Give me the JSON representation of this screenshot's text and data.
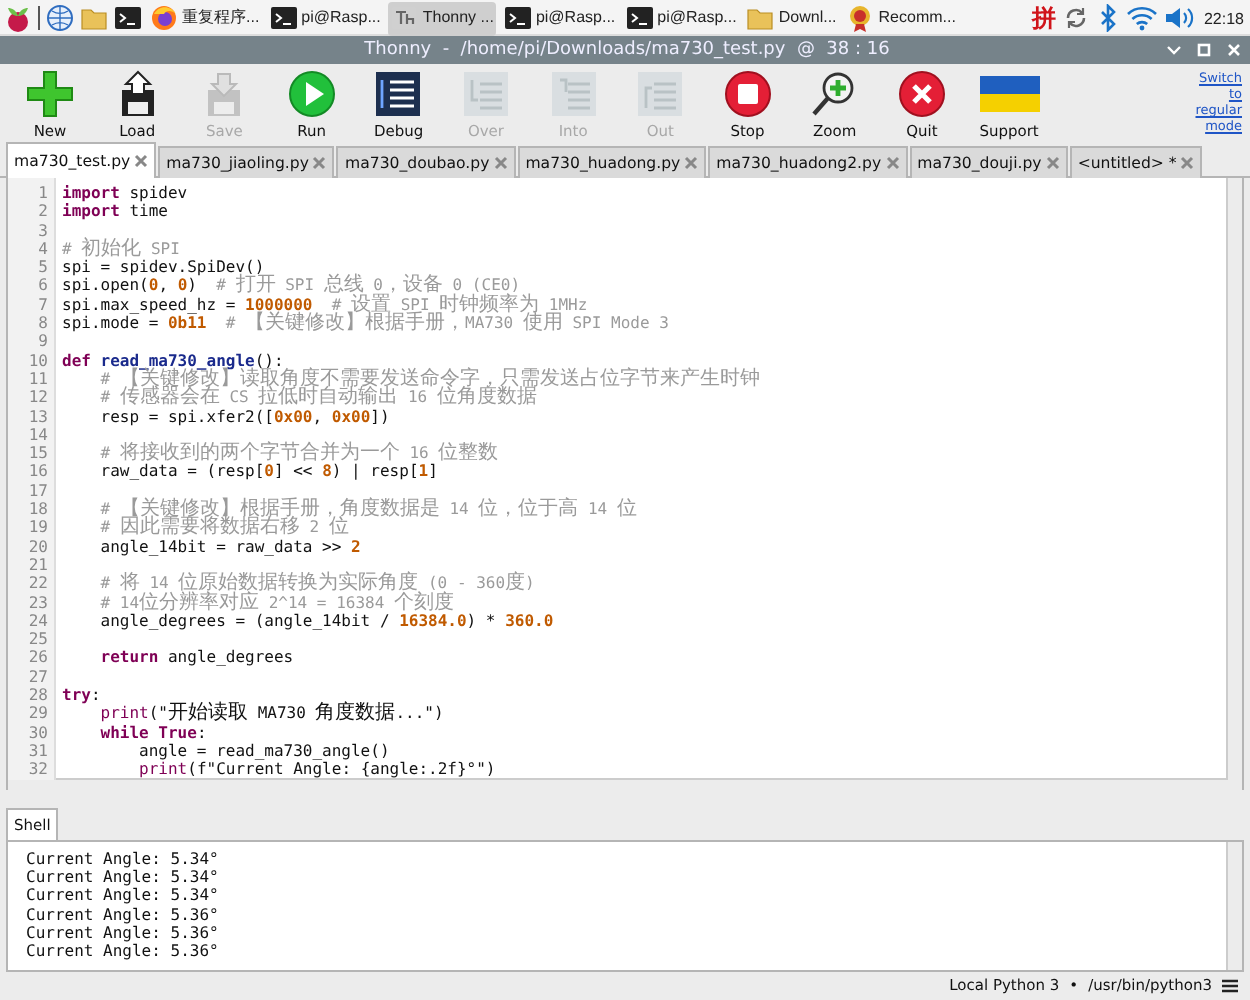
{
  "taskbar": {
    "windows": [
      {
        "kind": "firefox",
        "label": "重复程序...",
        "selected": false
      },
      {
        "kind": "terminal",
        "label": "pi@Rasp...",
        "selected": false
      },
      {
        "kind": "thonny",
        "label": "Thonny ...",
        "selected": true
      },
      {
        "kind": "terminal",
        "label": "pi@Rasp...",
        "selected": false
      },
      {
        "kind": "terminal",
        "label": "pi@Rasp...",
        "selected": false
      },
      {
        "kind": "folder",
        "label": "Downl...",
        "selected": false
      },
      {
        "kind": "rosette",
        "label": "Recomm...",
        "selected": false
      }
    ],
    "ime": "拼",
    "clock": "22:18"
  },
  "window": {
    "title": "Thonny  -  /home/pi/Downloads/ma730_test.py  @  38 : 16"
  },
  "toolbar": [
    {
      "kind": "new",
      "label": "New",
      "disabled": false
    },
    {
      "kind": "load",
      "label": "Load",
      "disabled": false
    },
    {
      "kind": "save",
      "label": "Save",
      "disabled": true
    },
    {
      "kind": "run",
      "label": "Run",
      "disabled": false
    },
    {
      "kind": "debug",
      "label": "Debug",
      "disabled": false
    },
    {
      "kind": "over",
      "label": "Over",
      "disabled": true
    },
    {
      "kind": "into",
      "label": "Into",
      "disabled": true
    },
    {
      "kind": "out",
      "label": "Out",
      "disabled": true
    },
    {
      "kind": "stop",
      "label": "Stop",
      "disabled": false
    },
    {
      "kind": "zoom",
      "label": "Zoom",
      "disabled": false
    },
    {
      "kind": "quit",
      "label": "Quit",
      "disabled": false
    },
    {
      "kind": "support",
      "label": "Support",
      "disabled": false
    }
  ],
  "mode_link": "Switch to regular mode",
  "editor_tabs": [
    {
      "label": "ma730_test.py",
      "selected": true
    },
    {
      "label": "ma730_jiaoling.py",
      "selected": false
    },
    {
      "label": "ma730_doubao.py",
      "selected": false
    },
    {
      "label": "ma730_huadong.py",
      "selected": false
    },
    {
      "label": "ma730_huadong2.py",
      "selected": false
    },
    {
      "label": "ma730_douji.py",
      "selected": false
    },
    {
      "label": "<untitled> *",
      "selected": false
    }
  ],
  "code_lines": [
    {
      "number": "1",
      "tokens": [
        {
          "kind": "keyword",
          "text": "import"
        },
        {
          "kind": "plain",
          "text": " spidev"
        }
      ]
    },
    {
      "number": "2",
      "tokens": [
        {
          "kind": "keyword",
          "text": "import"
        },
        {
          "kind": "plain",
          "text": " time"
        }
      ]
    },
    {
      "number": "3"
    },
    {
      "number": "4",
      "tokens": [
        {
          "kind": "comment",
          "text": "# 初始化 SPI"
        }
      ]
    },
    {
      "number": "5",
      "tokens": [
        {
          "kind": "plain",
          "text": "spi = spidev.SpiDev()"
        }
      ]
    },
    {
      "number": "6",
      "tokens": [
        {
          "kind": "plain",
          "text": "spi.open("
        },
        {
          "kind": "number",
          "text": "0"
        },
        {
          "kind": "plain",
          "text": ", "
        },
        {
          "kind": "number",
          "text": "0"
        },
        {
          "kind": "plain",
          "text": ")"
        },
        {
          "kind": "comment",
          "text": "  # 打开 SPI 总线 0，设备 0 (CE0)"
        }
      ]
    },
    {
      "number": "7",
      "tokens": [
        {
          "kind": "plain",
          "text": "spi.max_speed_hz = "
        },
        {
          "kind": "number",
          "text": "1000000"
        },
        {
          "kind": "comment",
          "text": "  # 设置 SPI 时钟频率为 1MHz"
        }
      ]
    },
    {
      "number": "8",
      "tokens": [
        {
          "kind": "plain",
          "text": "spi.mode = "
        },
        {
          "kind": "number",
          "text": "0b11"
        },
        {
          "kind": "comment",
          "text": "  # 【关键修改】根据手册，MA730 使用 SPI Mode 3"
        }
      ]
    },
    {
      "number": "9"
    },
    {
      "number": "10",
      "tokens": [
        {
          "kind": "keyword",
          "text": "def"
        },
        {
          "kind": "function",
          "text": " read_ma730_angle"
        },
        {
          "kind": "plain",
          "text": "():"
        }
      ]
    },
    {
      "number": "11",
      "tokens": [
        {
          "kind": "comment",
          "text": "    # 【关键修改】读取角度不需要发送命令字，只需发送占位字节来产生时钟"
        }
      ]
    },
    {
      "number": "12",
      "tokens": [
        {
          "kind": "comment",
          "text": "    # 传感器会在 CS 拉低时自动输出 16 位角度数据"
        }
      ]
    },
    {
      "number": "13",
      "tokens": [
        {
          "kind": "plain",
          "text": "    resp = spi.xfer2(["
        },
        {
          "kind": "number",
          "text": "0x00"
        },
        {
          "kind": "plain",
          "text": ", "
        },
        {
          "kind": "number",
          "text": "0x00"
        },
        {
          "kind": "plain",
          "text": "])"
        }
      ]
    },
    {
      "number": "14"
    },
    {
      "number": "15",
      "tokens": [
        {
          "kind": "comment",
          "text": "    # 将接收到的两个字节合并为一个 16 位整数"
        }
      ]
    },
    {
      "number": "16",
      "tokens": [
        {
          "kind": "plain",
          "text": "    raw_data = (resp["
        },
        {
          "kind": "number",
          "text": "0"
        },
        {
          "kind": "plain",
          "text": "] << "
        },
        {
          "kind": "number",
          "text": "8"
        },
        {
          "kind": "plain",
          "text": ") | resp["
        },
        {
          "kind": "number",
          "text": "1"
        },
        {
          "kind": "plain",
          "text": "]"
        }
      ]
    },
    {
      "number": "17"
    },
    {
      "number": "18",
      "tokens": [
        {
          "kind": "comment",
          "text": "    # 【关键修改】根据手册，角度数据是 14 位，位于高 14 位"
        }
      ]
    },
    {
      "number": "19",
      "tokens": [
        {
          "kind": "comment",
          "text": "    # 因此需要将数据右移 2 位"
        }
      ]
    },
    {
      "number": "20",
      "tokens": [
        {
          "kind": "plain",
          "text": "    angle_14bit = raw_data >> "
        },
        {
          "kind": "number",
          "text": "2"
        }
      ]
    },
    {
      "number": "21"
    },
    {
      "number": "22",
      "tokens": [
        {
          "kind": "comment",
          "text": "    # 将 14 位原始数据转换为实际角度 (0 - 360度)"
        }
      ]
    },
    {
      "number": "23",
      "tokens": [
        {
          "kind": "comment",
          "text": "    # 14位分辨率对应 2^14 = 16384 个刻度"
        }
      ]
    },
    {
      "number": "24",
      "tokens": [
        {
          "kind": "plain",
          "text": "    angle_degrees = (angle_14bit / "
        },
        {
          "kind": "number",
          "text": "16384.0"
        },
        {
          "kind": "plain",
          "text": ") * "
        },
        {
          "kind": "number",
          "text": "360.0"
        }
      ]
    },
    {
      "number": "25"
    },
    {
      "number": "26",
      "tokens": [
        {
          "kind": "keyword",
          "text": "    return"
        },
        {
          "kind": "plain",
          "text": " angle_degrees"
        }
      ]
    },
    {
      "number": "27"
    },
    {
      "number": "28",
      "tokens": [
        {
          "kind": "keyword",
          "text": "try"
        },
        {
          "kind": "plain",
          "text": ":"
        }
      ]
    },
    {
      "number": "29",
      "tokens": [
        {
          "kind": "builtin",
          "text": "    print"
        },
        {
          "kind": "plain",
          "text": "(\"开始读取 MA730 角度数据...\")"
        }
      ]
    },
    {
      "number": "30",
      "tokens": [
        {
          "kind": "keyword",
          "text": "    while"
        },
        {
          "kind": "keyword",
          "text": " True"
        },
        {
          "kind": "plain",
          "text": ":"
        }
      ]
    },
    {
      "number": "31",
      "tokens": [
        {
          "kind": "plain",
          "text": "        angle = read_ma730_angle()"
        }
      ]
    },
    {
      "number": "32",
      "tokens": [
        {
          "kind": "builtin",
          "text": "        print"
        },
        {
          "kind": "plain",
          "text": "(f\"Current Angle: {angle:.2f}°\")"
        }
      ]
    }
  ],
  "shell": {
    "tab": "Shell",
    "lines": [
      "Current Angle: 5.34°",
      "Current Angle: 5.34°",
      "Current Angle: 5.34°",
      "Current Angle: 5.36°",
      "Current Angle: 5.36°",
      "Current Angle: 5.36°"
    ]
  },
  "status_bar": {
    "interpreter": "Local Python 3",
    "separator": "•",
    "path": "/usr/bin/python3"
  }
}
